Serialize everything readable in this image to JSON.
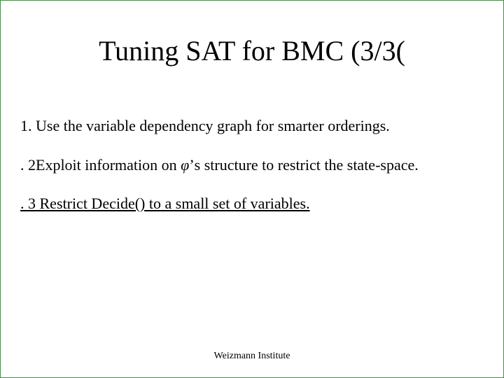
{
  "title": "Tuning SAT for BMC (3/3(",
  "items": {
    "i1": "1. Use the variable dependency graph for smarter orderings.",
    "i2_prefix": ". 2Exploit information on ",
    "i2_phi": "φ",
    "i2_suffix": "’s structure to restrict the state-space.",
    "i3": ". 3 Restrict Decide() to a small set of variables."
  },
  "footer": "Weizmann Institute"
}
